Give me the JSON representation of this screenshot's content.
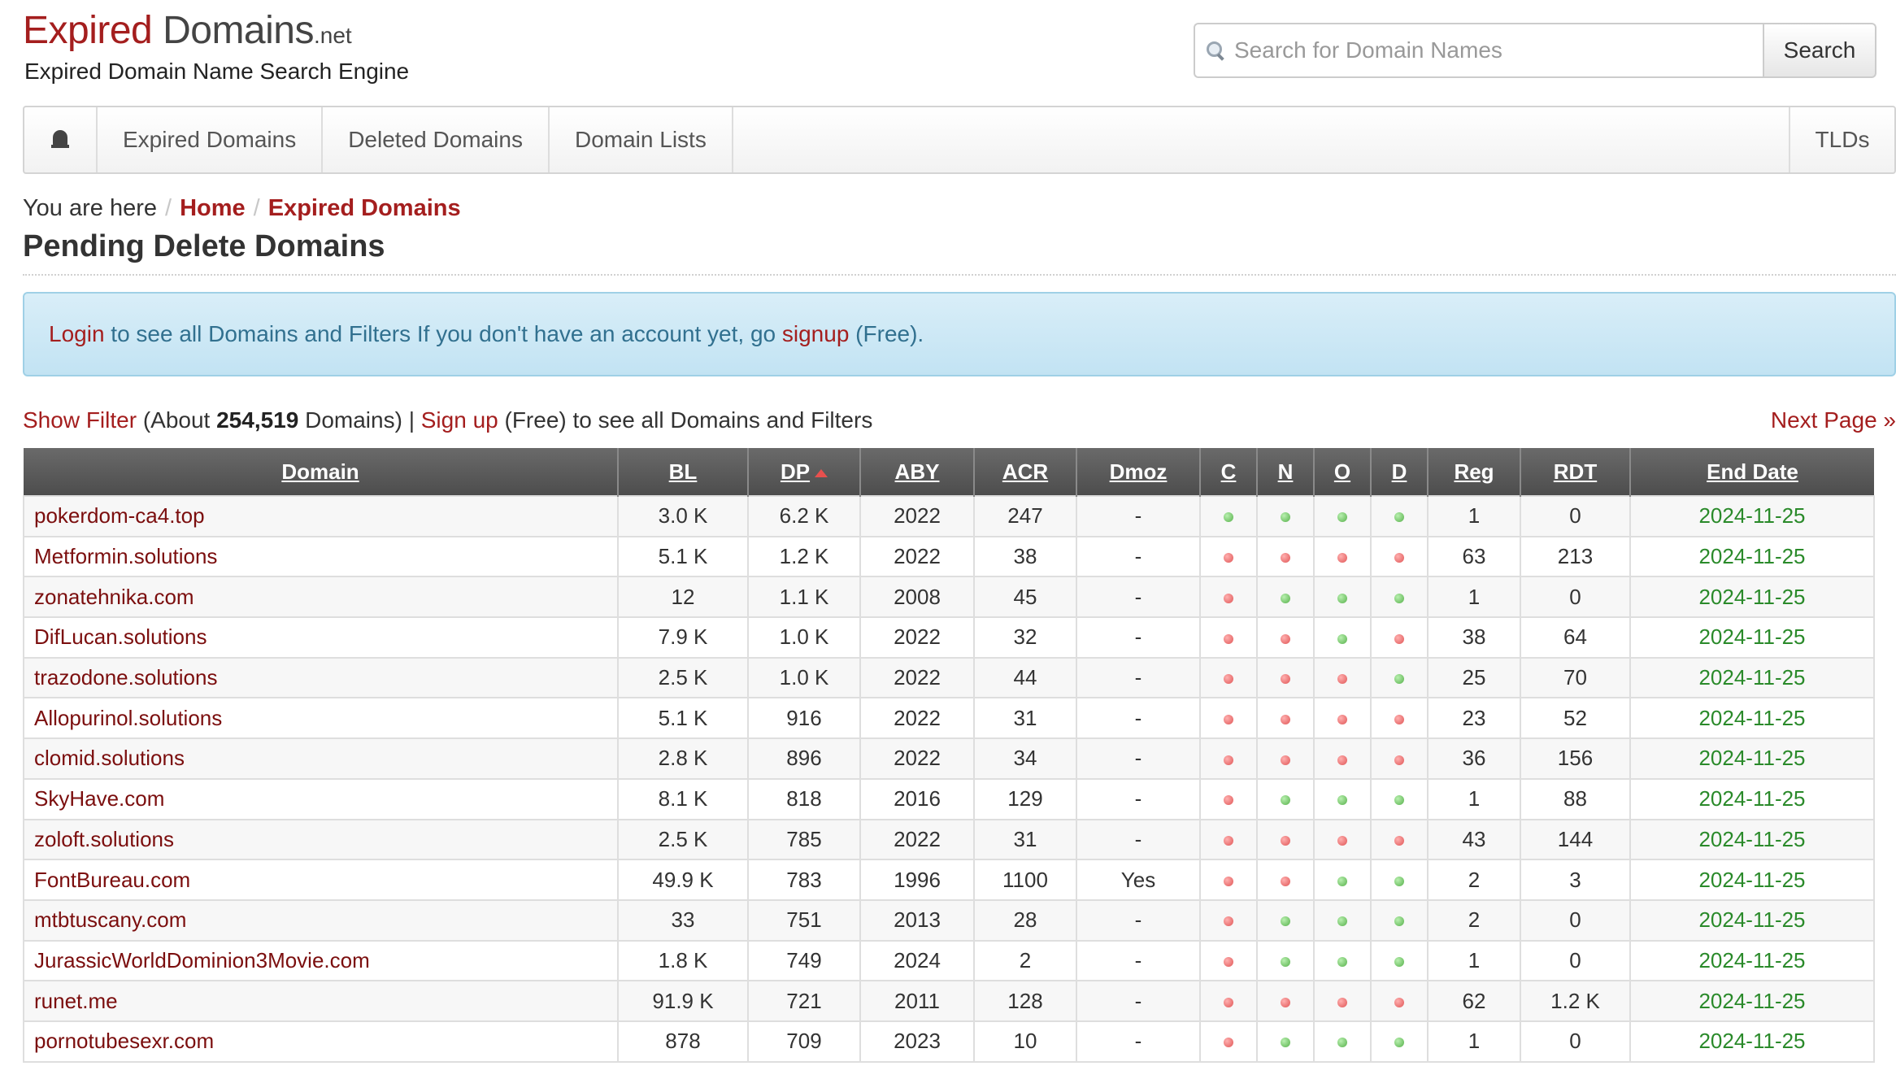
{
  "logo": {
    "expired": "Expired",
    "domains": " Domains",
    "tld": ".net"
  },
  "tagline": "Expired Domain Name Search Engine",
  "search": {
    "placeholder": "Search for Domain Names",
    "button": "Search"
  },
  "nav": {
    "items": [
      "Expired Domains",
      "Deleted Domains",
      "Domain Lists"
    ],
    "right": "TLDs"
  },
  "breadcrumb": {
    "prefix": "You are here",
    "sep": "/",
    "home": "Home",
    "current": "Expired Domains"
  },
  "title": "Pending Delete Domains",
  "alert": {
    "login": "Login",
    "text1": " to see all Domains and Filters If you don't have an account yet, go ",
    "signup": "signup",
    "text2": " (Free)."
  },
  "info": {
    "show_filter": "Show Filter",
    "about_prefix": " (About ",
    "count": "254,519",
    "about_suffix": " Domains) | ",
    "signup": "Sign up",
    "suffix": " (Free) to see all Domains and Filters",
    "next": "Next Page »"
  },
  "colors": {
    "accent": "#a41e1e",
    "date": "#2a8a2a",
    "ok": "#56b04a",
    "taken": "#e05555"
  },
  "table": {
    "headers": [
      "Domain",
      "BL",
      "DP",
      "ABY",
      "ACR",
      "Dmoz",
      "C",
      "N",
      "O",
      "D",
      "Reg",
      "RDT",
      "End Date"
    ],
    "rows": [
      [
        "pokerdom-ca4.top",
        "3.0 K",
        "6.2 K",
        "2022",
        "247",
        "-",
        "g",
        "g",
        "g",
        "g",
        "1",
        "0",
        "2024-11-25"
      ],
      [
        "Metformin.solutions",
        "5.1 K",
        "1.2 K",
        "2022",
        "38",
        "-",
        "r",
        "r",
        "r",
        "r",
        "63",
        "213",
        "2024-11-25"
      ],
      [
        "zonatehnika.com",
        "12",
        "1.1 K",
        "2008",
        "45",
        "-",
        "r",
        "g",
        "g",
        "g",
        "1",
        "0",
        "2024-11-25"
      ],
      [
        "DifLucan.solutions",
        "7.9 K",
        "1.0 K",
        "2022",
        "32",
        "-",
        "r",
        "r",
        "g",
        "r",
        "38",
        "64",
        "2024-11-25"
      ],
      [
        "trazodone.solutions",
        "2.5 K",
        "1.0 K",
        "2022",
        "44",
        "-",
        "r",
        "r",
        "r",
        "g",
        "25",
        "70",
        "2024-11-25"
      ],
      [
        "Allopurinol.solutions",
        "5.1 K",
        "916",
        "2022",
        "31",
        "-",
        "r",
        "r",
        "r",
        "r",
        "23",
        "52",
        "2024-11-25"
      ],
      [
        "clomid.solutions",
        "2.8 K",
        "896",
        "2022",
        "34",
        "-",
        "r",
        "r",
        "r",
        "r",
        "36",
        "156",
        "2024-11-25"
      ],
      [
        "SkyHave.com",
        "8.1 K",
        "818",
        "2016",
        "129",
        "-",
        "r",
        "g",
        "g",
        "g",
        "1",
        "88",
        "2024-11-25"
      ],
      [
        "zoloft.solutions",
        "2.5 K",
        "785",
        "2022",
        "31",
        "-",
        "r",
        "r",
        "r",
        "r",
        "43",
        "144",
        "2024-11-25"
      ],
      [
        "FontBureau.com",
        "49.9 K",
        "783",
        "1996",
        "1100",
        "Yes",
        "r",
        "r",
        "g",
        "g",
        "2",
        "3",
        "2024-11-25"
      ],
      [
        "mtbtuscany.com",
        "33",
        "751",
        "2013",
        "28",
        "-",
        "r",
        "g",
        "g",
        "g",
        "2",
        "0",
        "2024-11-25"
      ],
      [
        "JurassicWorldDominion3Movie.com",
        "1.8 K",
        "749",
        "2024",
        "2",
        "-",
        "r",
        "g",
        "g",
        "g",
        "1",
        "0",
        "2024-11-25"
      ],
      [
        "runet.me",
        "91.9 K",
        "721",
        "2011",
        "128",
        "-",
        "r",
        "r",
        "r",
        "r",
        "62",
        "1.2 K",
        "2024-11-25"
      ],
      [
        "pornotubesexr.com",
        "878",
        "709",
        "2023",
        "10",
        "-",
        "r",
        "g",
        "g",
        "g",
        "1",
        "0",
        "2024-11-25"
      ]
    ]
  }
}
